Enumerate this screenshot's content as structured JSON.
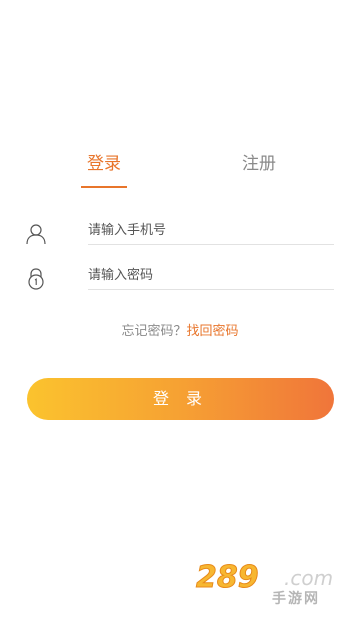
{
  "tabs": {
    "login": "登录",
    "register": "注册"
  },
  "form": {
    "phone_placeholder": "请输入手机号",
    "password_placeholder": "请输入密码"
  },
  "forgot": {
    "text": "忘记密码？",
    "link": "找回密码"
  },
  "login_button": "登 录",
  "watermark": {
    "number": "289",
    "domain": ".com",
    "cn_text": "手游网"
  },
  "colors": {
    "accent": "#e8752b",
    "gradient_start": "#fbc32e",
    "gradient_end": "#f0753a"
  },
  "icons": [
    "user-icon",
    "lock-icon"
  ]
}
